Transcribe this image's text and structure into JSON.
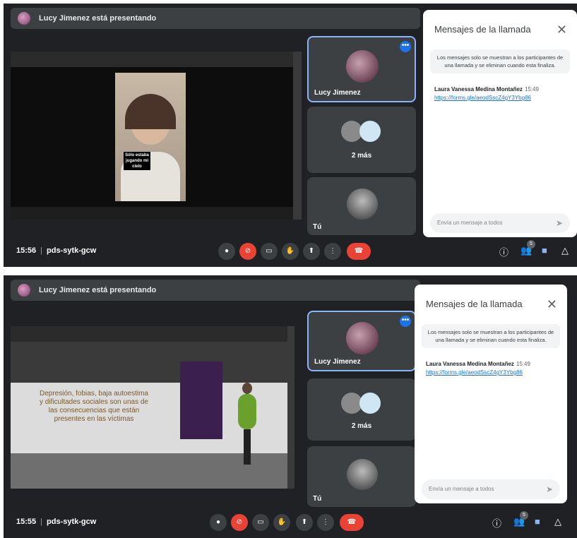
{
  "screens": [
    {
      "banner": "Lucy Jimenez está presentando",
      "time": "15:56",
      "meeting_code": "pds-sytk-gcw",
      "caption": "Sólo estaba jugando mi cielo",
      "tiles": {
        "presenter": "Lucy Jimenez",
        "more": "2 más",
        "self": "Tú"
      },
      "chat": {
        "title": "Mensajes de la llamada",
        "note": "Los mensajes solo se muestran a los participantes de una llamada y se eliminan cuando esta finaliza.",
        "sender": "Laura Vanessa Medina Montañez",
        "sent_time": "15:49",
        "link": "https://forms.gle/aeodSscZ4gY3Ybg86",
        "placeholder": "Envía un mensaje a todos"
      },
      "people_count": "5"
    },
    {
      "banner": "Lucy Jimenez está presentando",
      "time": "15:55",
      "meeting_code": "pds-sytk-gcw",
      "slide_text": "Depresión, fobias, baja autoestima y dificultades sociales son unas de las consecuencias que están presentes en las víctimas",
      "tiles": {
        "presenter": "Lucy Jimenez",
        "more": "2 más",
        "self": "Tú"
      },
      "chat": {
        "title": "Mensajes de la llamada",
        "note": "Los mensajes solo se muestran a los participantes de una llamada y se eliminan cuando esta finaliza.",
        "sender": "Laura Vanessa Medina Montañez",
        "sent_time": "15:49",
        "link": "https://forms.gle/aeodSscZ4gY3Ybg86",
        "placeholder": "Envía un mensaje a todos"
      },
      "people_count": "5"
    }
  ],
  "icons": [
    "mic-icon",
    "camera-off-icon",
    "captions-icon",
    "raise-hand-icon",
    "present-icon",
    "more-icon",
    "hang-up-icon",
    "info-icon",
    "people-icon",
    "chat-icon",
    "activities-icon",
    "send-icon",
    "close-icon"
  ],
  "colors": {
    "background": "#202124",
    "accent": "#1a73e8",
    "danger": "#ea4335",
    "tile": "#3c4043"
  }
}
